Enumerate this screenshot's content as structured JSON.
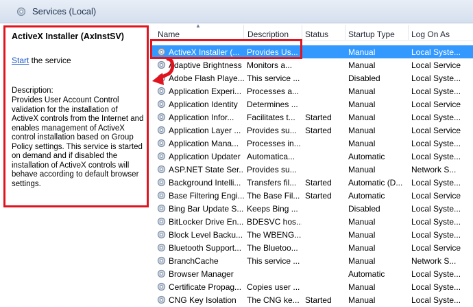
{
  "header": {
    "title": "Services (Local)",
    "icon": "services-gear-icon"
  },
  "description_pane": {
    "service_name": "ActiveX Installer (AxInstSV)",
    "start_link": "Start",
    "start_suffix": " the service",
    "description_label": "Description:",
    "description_text": "Provides User Account Control validation for the installation of ActiveX controls from the Internet and enables management of ActiveX control installation based on Group Policy settings. This service is started on demand and if disabled the installation of ActiveX controls will behave according to default browser settings."
  },
  "columns": {
    "name": "Name",
    "description": "Description",
    "status": "Status",
    "startup_type": "Startup Type",
    "log_on_as": "Log On As"
  },
  "rows": [
    {
      "name": "ActiveX Installer (...",
      "description": "Provides Us...",
      "status": "",
      "startup": "Manual",
      "logon": "Local Syste...",
      "selected": true
    },
    {
      "name": "Adaptive Brightness",
      "description": "Monitors a...",
      "status": "",
      "startup": "Manual",
      "logon": "Local Service"
    },
    {
      "name": "Adobe Flash Playe...",
      "description": "This service ...",
      "status": "",
      "startup": "Disabled",
      "logon": "Local Syste..."
    },
    {
      "name": "Application Experi...",
      "description": "Processes a...",
      "status": "",
      "startup": "Manual",
      "logon": "Local Syste..."
    },
    {
      "name": "Application Identity",
      "description": "Determines ...",
      "status": "",
      "startup": "Manual",
      "logon": "Local Service"
    },
    {
      "name": "Application Infor...",
      "description": "Facilitates t...",
      "status": "Started",
      "startup": "Manual",
      "logon": "Local Syste..."
    },
    {
      "name": "Application Layer ...",
      "description": "Provides su...",
      "status": "Started",
      "startup": "Manual",
      "logon": "Local Service"
    },
    {
      "name": "Application Mana...",
      "description": "Processes in...",
      "status": "",
      "startup": "Manual",
      "logon": "Local Syste..."
    },
    {
      "name": "Application Updater",
      "description": "Automatica...",
      "status": "",
      "startup": "Automatic",
      "logon": "Local Syste..."
    },
    {
      "name": "ASP.NET State Ser...",
      "description": "Provides su...",
      "status": "",
      "startup": "Manual",
      "logon": "Network S..."
    },
    {
      "name": "Background Intelli...",
      "description": "Transfers fil...",
      "status": "Started",
      "startup": "Automatic (D...",
      "logon": "Local Syste..."
    },
    {
      "name": "Base Filtering Engi...",
      "description": "The Base Fil...",
      "status": "Started",
      "startup": "Automatic",
      "logon": "Local Service"
    },
    {
      "name": "Bing Bar Update S...",
      "description": "Keeps Bing ...",
      "status": "",
      "startup": "Disabled",
      "logon": "Local Syste..."
    },
    {
      "name": "BitLocker Drive En...",
      "description": "BDESVC hos...",
      "status": "",
      "startup": "Manual",
      "logon": "Local Syste..."
    },
    {
      "name": "Block Level Backu...",
      "description": "The WBENG...",
      "status": "",
      "startup": "Manual",
      "logon": "Local Syste..."
    },
    {
      "name": "Bluetooth Support...",
      "description": "The Bluetoo...",
      "status": "",
      "startup": "Manual",
      "logon": "Local Service"
    },
    {
      "name": "BranchCache",
      "description": "This service ...",
      "status": "",
      "startup": "Manual",
      "logon": "Network S..."
    },
    {
      "name": "Browser Manager",
      "description": "",
      "status": "",
      "startup": "Automatic",
      "logon": "Local Syste..."
    },
    {
      "name": "Certificate Propag...",
      "description": "Copies user ...",
      "status": "",
      "startup": "Manual",
      "logon": "Local Syste..."
    },
    {
      "name": "CNG Key Isolation",
      "description": "The CNG ke...",
      "status": "Started",
      "startup": "Manual",
      "logon": "Local Syste..."
    }
  ],
  "colors": {
    "selection": "#3399ff",
    "highlight": "#e0141e",
    "link": "#1a56c4"
  }
}
